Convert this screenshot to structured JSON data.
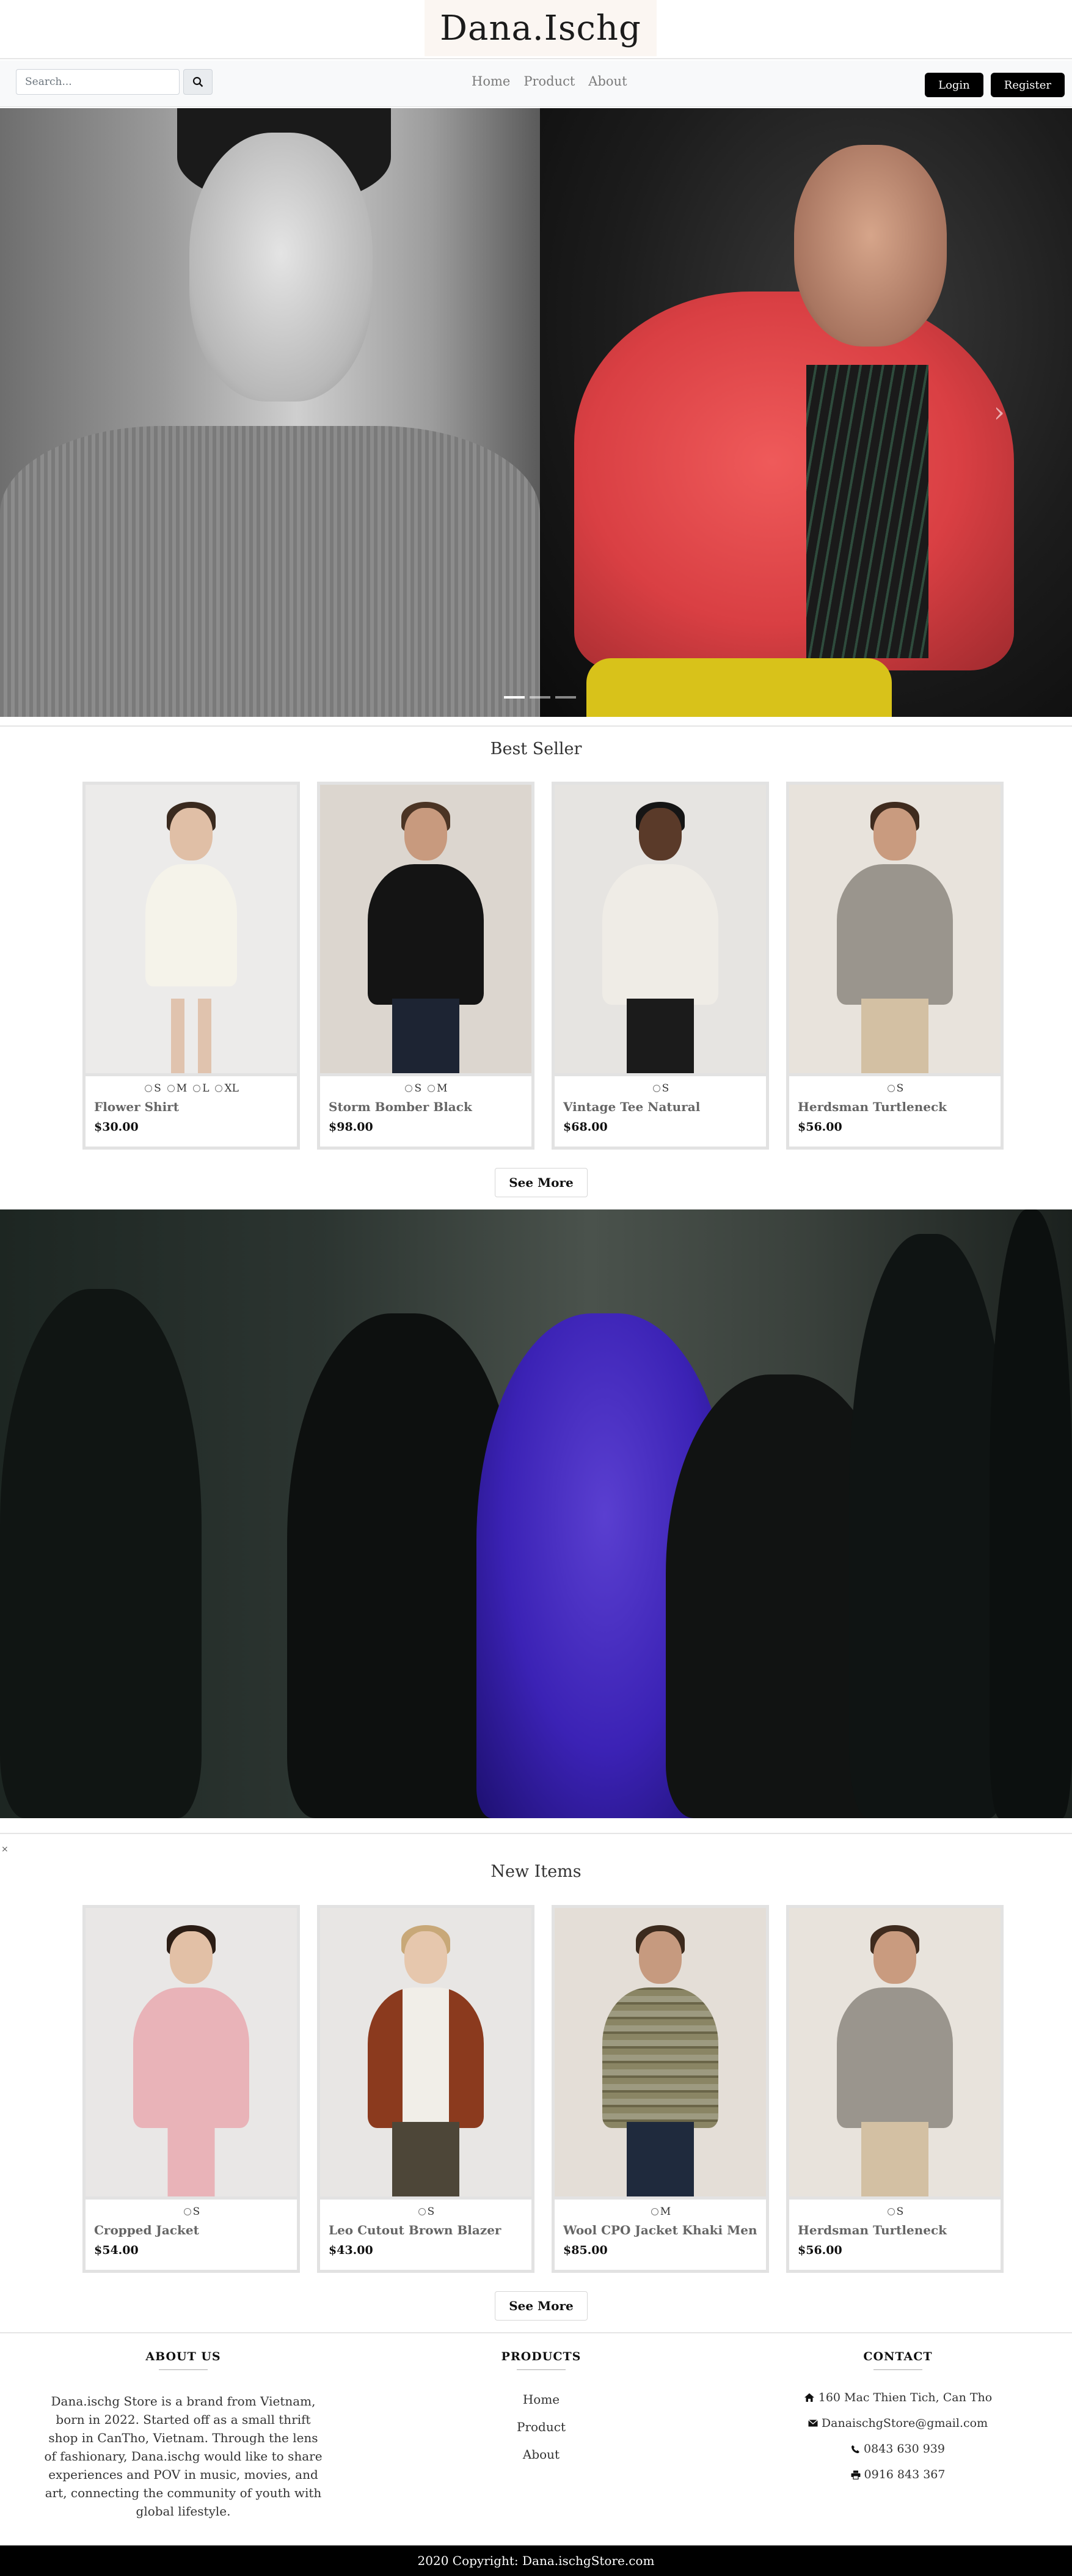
{
  "brand": {
    "logo": "Dana.Ischg"
  },
  "nav": {
    "search_placeholder": "Search...",
    "links": [
      "Home",
      "Product",
      "About"
    ],
    "login": "Login",
    "register": "Register"
  },
  "hero": {
    "slides": 3,
    "active_slide": 1
  },
  "best_seller": {
    "title": "Best Seller",
    "items": [
      {
        "name": "Flower Shirt",
        "price": "$30.00",
        "sizes": [
          "S",
          "M",
          "L",
          "XL"
        ]
      },
      {
        "name": "Storm Bomber Black",
        "price": "$98.00",
        "sizes": [
          "S",
          "M"
        ]
      },
      {
        "name": "Vintage Tee Natural",
        "price": "$68.00",
        "sizes": [
          "S"
        ]
      },
      {
        "name": "Herdsman Turtleneck",
        "price": "$56.00",
        "sizes": [
          "S"
        ]
      }
    ],
    "see_more": "See More"
  },
  "close_glyph": "×",
  "new_items": {
    "title": "New Items",
    "items": [
      {
        "name": "Cropped Jacket",
        "price": "$54.00",
        "sizes": [
          "S"
        ]
      },
      {
        "name": "Leo Cutout Brown Blazer",
        "price": "$43.00",
        "sizes": [
          "S"
        ]
      },
      {
        "name": "Wool CPO Jacket Khaki Men",
        "price": "$85.00",
        "sizes": [
          "M"
        ]
      },
      {
        "name": "Herdsman Turtleneck",
        "price": "$56.00",
        "sizes": [
          "S"
        ]
      }
    ],
    "see_more": "See More"
  },
  "footer": {
    "about_title": "ABOUT US",
    "about_text": "Dana.ischg Store is a brand from Vietnam, born in 2022. Started off as a small thrift shop in CanTho, Vietnam. Through the lens of fashionary, Dana.ischg would like to share experiences and POV in music, movies, and art, connecting the community of youth with global lifestyle.",
    "products_title": "PRODUCTS",
    "product_links": [
      "Home",
      "Product",
      "About"
    ],
    "contact_title": "CONTACT",
    "address": "160 Mac Thien Tich, Can Tho",
    "email": "DanaischgStore@gmail.com",
    "phone": "0843 630 939",
    "fax": "0916 843 367",
    "copyright": "2020 Copyright: Dana.ischgStore.com"
  }
}
